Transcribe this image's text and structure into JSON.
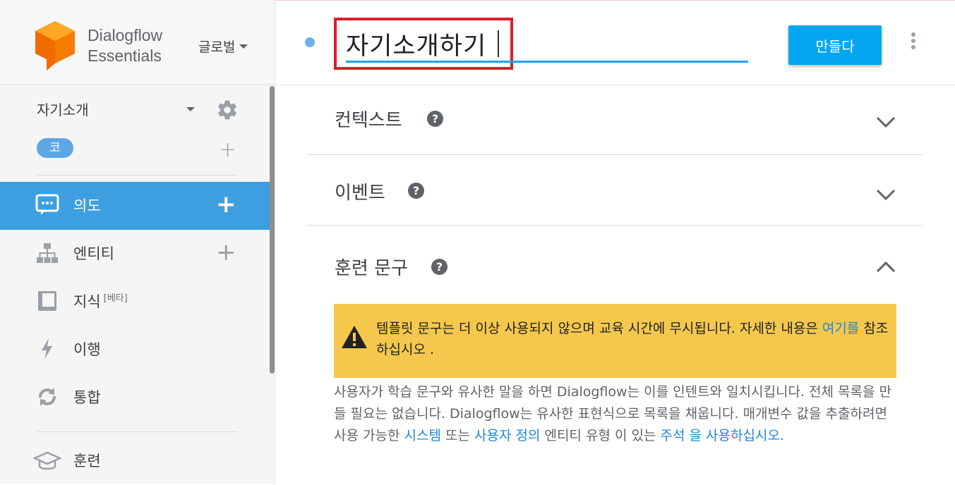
{
  "brand": {
    "line1": "Dialogflow",
    "line2": "Essentials",
    "region": "글로벌"
  },
  "agent": {
    "name": "자기소개",
    "language_badge": "코"
  },
  "nav": [
    {
      "label": "의도",
      "icon": "chat-icon",
      "has_plus": true,
      "active": true
    },
    {
      "label": "엔티티",
      "icon": "hierarchy-icon",
      "has_plus": true,
      "active": false
    },
    {
      "label": "지식",
      "badge": "[베타]",
      "icon": "book-icon",
      "has_plus": false,
      "active": false
    },
    {
      "label": "이행",
      "icon": "bolt-icon",
      "has_plus": false,
      "active": false
    },
    {
      "label": "통합",
      "icon": "sync-icon",
      "has_plus": false,
      "active": false
    },
    {
      "label": "훈련",
      "icon": "graduation-cap-icon",
      "has_plus": false,
      "active": false
    }
  ],
  "intent": {
    "name_value": "자기소개하기",
    "create_button": "만들다"
  },
  "sections": {
    "contexts": "컨텍스트",
    "events": "이벤트",
    "training": "훈련 문구"
  },
  "help_glyph": "?",
  "plus_glyph": "+",
  "warning": {
    "text_before": "템플릿 문구는 더 이상 사용되지 않으며 교육 시간에 무시됩니다. 자세한 내용은 ",
    "link": "여기를",
    "text_after": " 참조하십시오 ."
  },
  "description": {
    "part1": "사용자가 학습 문구와 유사한 말을 하면 Dialogflow는 이를 인텐트와 일치시킵니다. 전체 목록을 만들 필요는 없습니다. Dialogflow는 유사한 표현식으로 목록을 채웁니다. 매개변수 값을 추출하려면 사용 가능한 ",
    "link_system": "시스템",
    "part2": " 또는 ",
    "link_user": "사용자 정의",
    "part3": " 엔티티 유형 이 있는 ",
    "link_annot": "주석 을 사용하십시오."
  },
  "colors": {
    "accent_blue": "#3d9fe0",
    "create_button": "#02a7f0",
    "highlight_red": "#e21b2c",
    "warning_bg": "#f5c84d",
    "logo_orange": "#f57c00"
  }
}
